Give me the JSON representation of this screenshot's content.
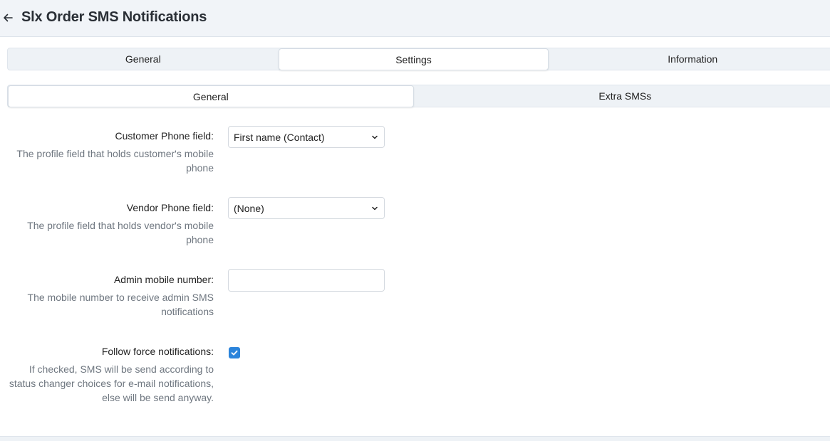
{
  "header": {
    "title": "Slx Order SMS Notifications",
    "back_icon": "arrow-left-icon"
  },
  "main_tabs": [
    {
      "label": "General",
      "active": false
    },
    {
      "label": "Settings",
      "active": true
    },
    {
      "label": "Information",
      "active": false
    }
  ],
  "sub_tabs": [
    {
      "label": "General",
      "active": true
    },
    {
      "label": "Extra SMSs",
      "active": false
    }
  ],
  "form": {
    "customer_phone": {
      "label": "Customer Phone field:",
      "description": "The profile field that holds customer's mobile phone",
      "value": "First name (Contact)"
    },
    "vendor_phone": {
      "label": "Vendor Phone field:",
      "description": "The profile field that holds vendor's mobile phone",
      "value": "(None)"
    },
    "admin_mobile": {
      "label": "Admin mobile number:",
      "description": "The mobile number to receive admin SMS notifications",
      "value": ""
    },
    "follow_force": {
      "label": "Follow force notifications:",
      "description": "If checked, SMS will be send according to status changer choices for e-mail notifications, else will be send anyway.",
      "checked": true
    }
  },
  "colors": {
    "accent": "#2b84db",
    "header_bg": "#f1f4f8"
  }
}
